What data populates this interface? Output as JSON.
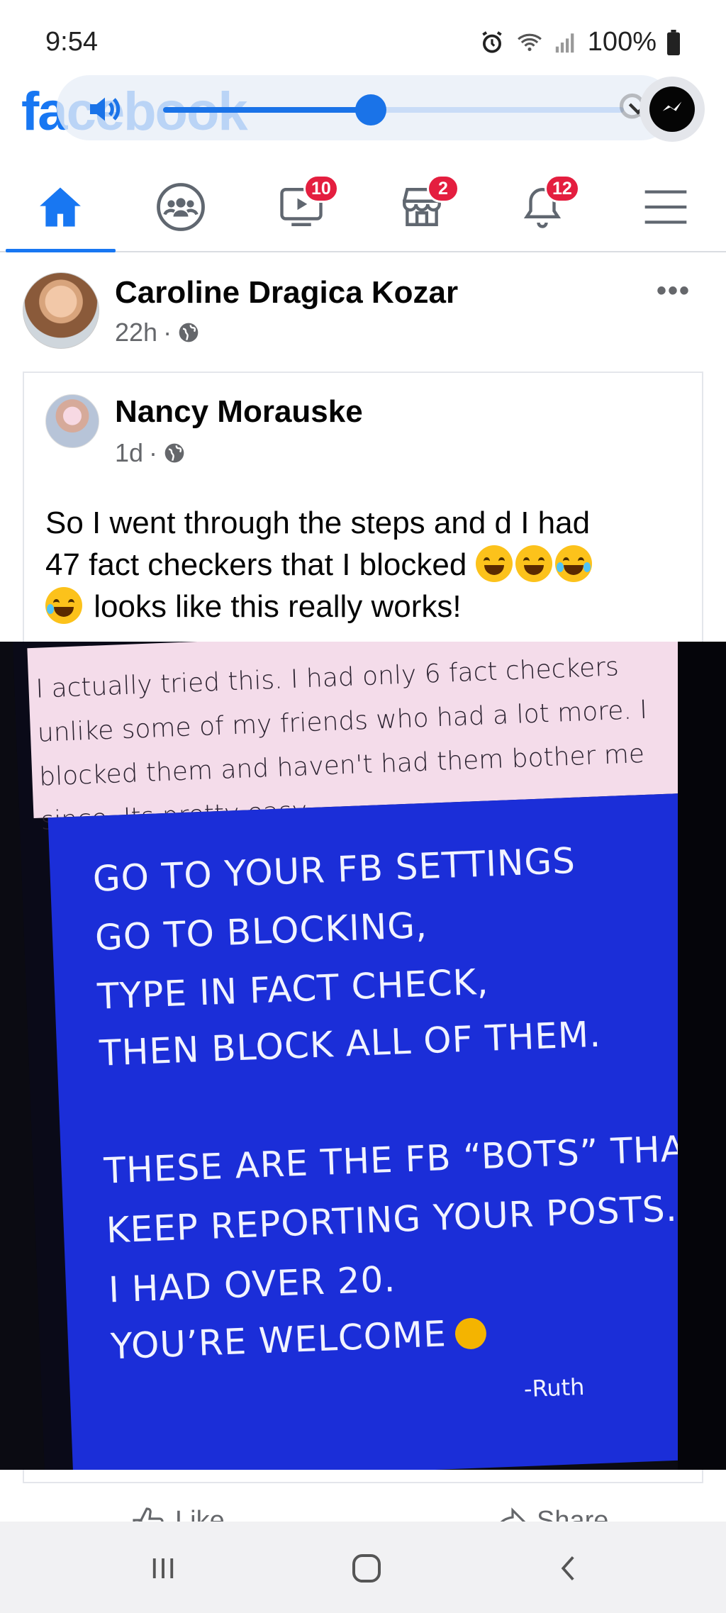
{
  "status_bar": {
    "time": "9:54",
    "battery": "100%",
    "icons": [
      "alarm-icon",
      "wifi-icon",
      "signal-icon",
      "battery-icon"
    ]
  },
  "header": {
    "logo": "facebook",
    "volume_level_percent": 45,
    "icons": [
      "speaker-icon",
      "search-icon",
      "chevron-down-icon",
      "messenger-icon"
    ]
  },
  "nav": {
    "tabs": [
      {
        "name": "home",
        "icon": "home-icon",
        "badge": ""
      },
      {
        "name": "groups",
        "icon": "groups-icon",
        "badge": ""
      },
      {
        "name": "watch",
        "icon": "video-icon",
        "badge": "10"
      },
      {
        "name": "marketplace",
        "icon": "store-icon",
        "badge": "2"
      },
      {
        "name": "notifications",
        "icon": "bell-icon",
        "badge": "12"
      },
      {
        "name": "menu",
        "icon": "menu-icon",
        "badge": ""
      }
    ],
    "active": "home"
  },
  "post": {
    "author": "Caroline Dragica Kozar",
    "time": "22h",
    "more": "•••",
    "shared": {
      "author": "Nancy Morauske",
      "time": "1d",
      "text_line1": "So I  went through the steps and d I had",
      "text_line2": "47 fact checkers  that I blocked",
      "text_line3": "looks like this really works!",
      "image": {
        "note_line1": "I actually tried this. I had only 6 fact checkers",
        "note_line2": "unlike some of my friends who had a lot more. I",
        "note_line3": "blocked them and haven't had them bother me",
        "note_line4": "since.  Its pretty easy.",
        "l1": "GO TO YOUR FB SETTINGS",
        "l2": "GO TO BLOCKING,",
        "l3": "TYPE IN FACT CHECK,",
        "l4": "THEN BLOCK ALL OF THEM.",
        "l5": "THESE ARE THE FB “BOTS” THAT",
        "l6": "KEEP REPORTING YOUR POSTS.",
        "l7": "I HAD OVER 20.",
        "l8": "YOU’RE WELCOME",
        "signature": "-Ruth"
      }
    },
    "actions": {
      "like": "Like",
      "share": "Share"
    }
  },
  "android_nav": {
    "icons": [
      "recent-apps-icon",
      "home-circle-icon",
      "back-icon"
    ]
  },
  "colors": {
    "brand": "#1877f2",
    "badge": "#e41e3f",
    "panel": "#1b2ed8"
  }
}
